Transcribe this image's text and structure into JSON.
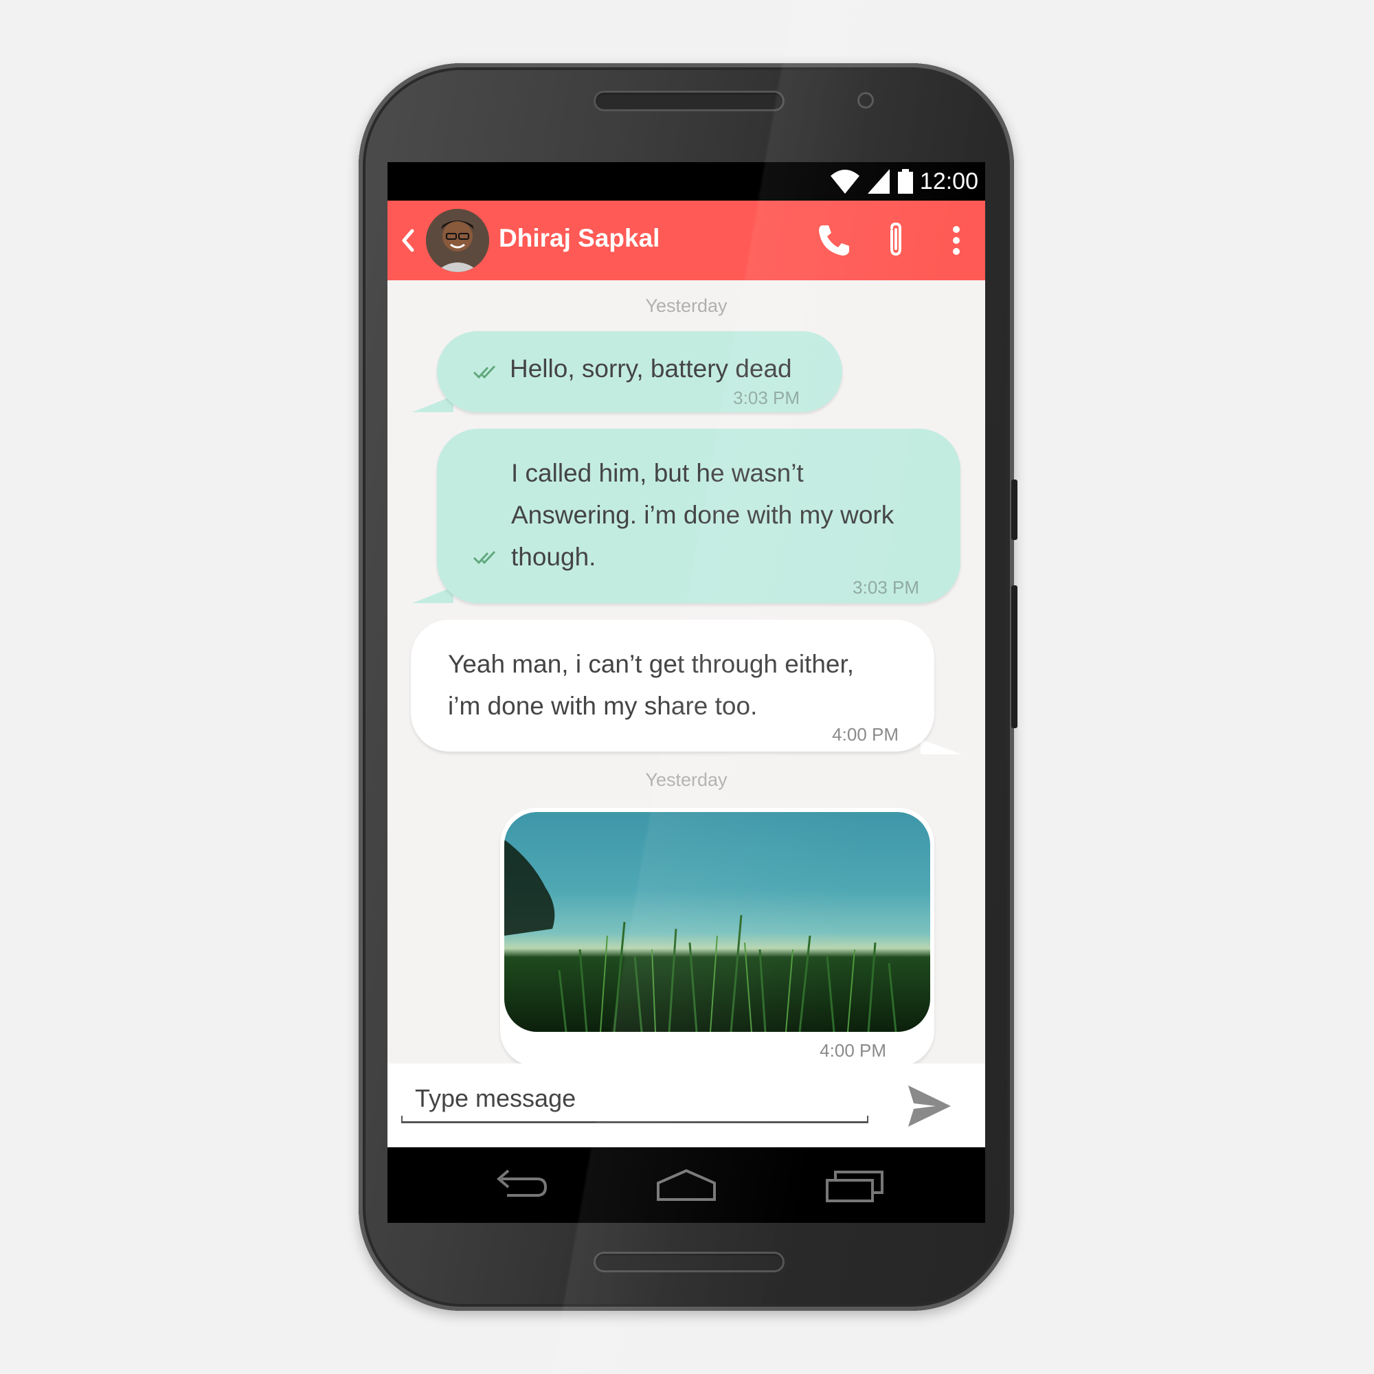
{
  "status_bar": {
    "time": "12:00"
  },
  "header": {
    "contact_name": "Dhiraj Sapkal"
  },
  "chat": {
    "day_label_1": "Yesterday",
    "msg1": {
      "text": "Hello, sorry, battery dead",
      "time": "3:03 PM"
    },
    "msg2": {
      "line1": "I called him, but he wasn’t",
      "line2": "Answering. i’m done with my work",
      "line3": "though.",
      "time": "3:03 PM"
    },
    "msg3": {
      "line1": "Yeah man, i can’t get through either,",
      "line2": "i’m done with my share too.",
      "time": "4:00 PM"
    },
    "day_label_2": "Yesterday",
    "msg4": {
      "time": "4:00 PM"
    }
  },
  "composer": {
    "placeholder": "Type message"
  },
  "colors": {
    "accent": "#ff5a55",
    "outgoing_bubble": "#c3ece1",
    "incoming_bubble": "#ffffff"
  },
  "icons": [
    "back-icon",
    "phone-icon",
    "attach-icon",
    "more-icon",
    "double-check-icon",
    "send-icon",
    "nav-back-icon",
    "nav-home-icon",
    "nav-recents-icon",
    "wifi-icon",
    "signal-icon",
    "battery-icon"
  ]
}
